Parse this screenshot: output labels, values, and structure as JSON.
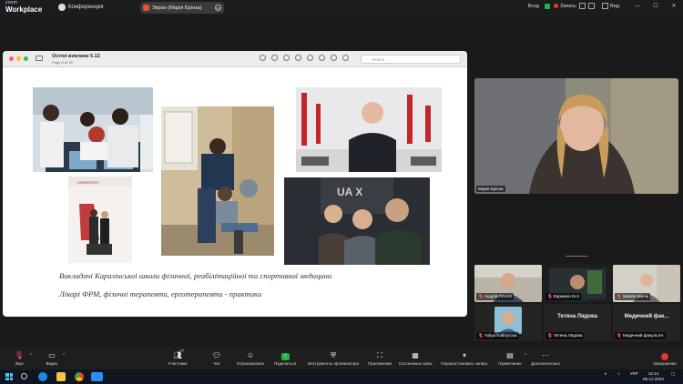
{
  "app": {
    "logo_line1": "zoom",
    "logo_line2": "Workplace",
    "conference_label": "Конференция",
    "share_label": "Экран (Марія Брінза)",
    "share_menu_icon": "more-icon"
  },
  "topbar": {
    "enter_label": "Вход",
    "record_label": "Запись",
    "view_label": "Вид"
  },
  "shared_window": {
    "doc_title": "Осiтнi виклики 5.12",
    "doc_sub": "Page 8 of 15",
    "search_placeholder": "Search",
    "captions": [
      "Викладачі Каразінської школи фізичної, реабілітаційної та спортивної медицини",
      "Лікарі ФРМ, фізичні терапевти, ерготерапевти - практики"
    ]
  },
  "self_video": {
    "name": "Марія Брінза"
  },
  "gallery": {
    "tiles": [
      {
        "name": "Андрій ПАЧУК"
      },
      {
        "name": "Кармазін Есл"
      },
      {
        "name": "Natalie Шелю"
      },
      {
        "name": "Yuliya Kalinycova"
      },
      {
        "big": "Тетяна Лядова",
        "name": "Тетяна Лядова"
      },
      {
        "big": "Медичний фак...",
        "name": "Медичний факультет"
      }
    ]
  },
  "toolbar": {
    "audio": "Звук",
    "video": "Видео",
    "participants": "Участники",
    "participants_count": "27",
    "chat": "Чат",
    "react": "Отреагировать",
    "share": "Поделиться",
    "host_tools": "Инструменты организатора",
    "apps": "Приложения",
    "breakout": "Сессионные залы",
    "pause_share": "Пауза/остановить запись",
    "notes": "Примечание",
    "more": "Дополнительно",
    "end": "Завершение"
  },
  "taskbar": {
    "lang": "УКР",
    "time": "12:14",
    "date": "05.12.2024"
  },
  "colors": {
    "zoom_blue": "#0e72ed",
    "record_red": "#e53935",
    "share_green": "#22b14c",
    "end_red": "#e0392b"
  }
}
